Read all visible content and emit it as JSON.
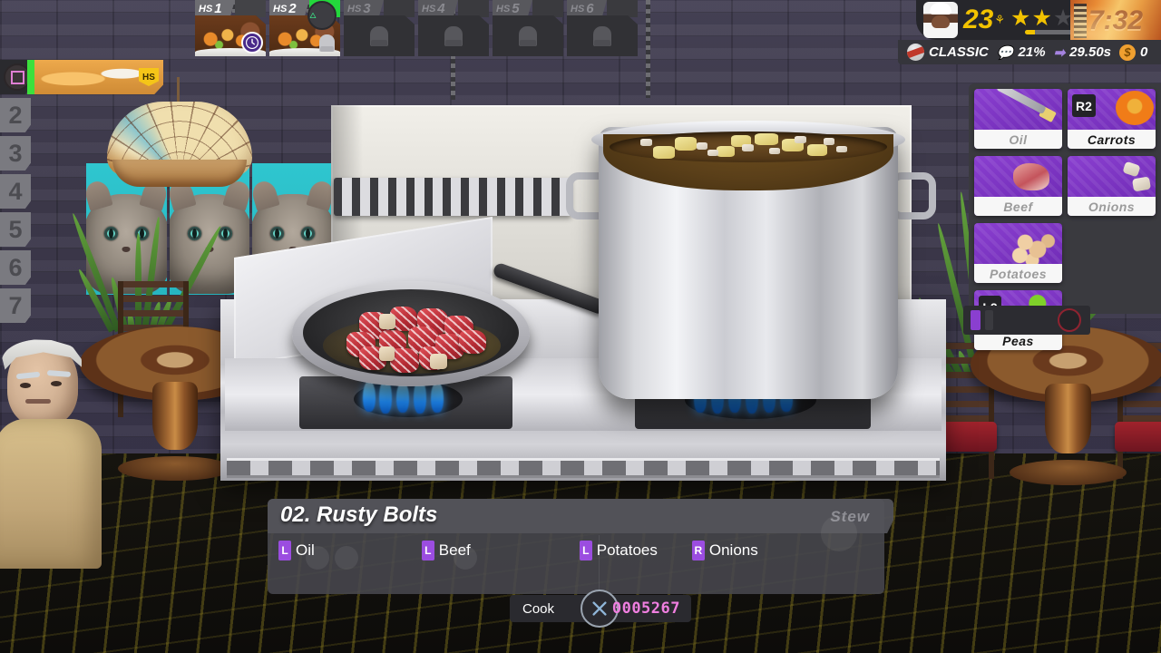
{
  "hud": {
    "score": "23",
    "score_icon": "chopsticks-icon",
    "stars_total": 5,
    "stars_earned": 2,
    "xp_percent": 8,
    "timer": "7:32",
    "mode": "CLASSIC",
    "buzz_percent": "21%",
    "time_remaining": "29.50s",
    "money": "0",
    "accent_gold": "#f2c200",
    "accent_purple": "#9b4de0",
    "accent_pink": "#f07fe0"
  },
  "hold_station": [
    {
      "tab": "HS",
      "num": "1",
      "state": "filled",
      "badge": "clock-icon",
      "top_color": "#434347"
    },
    {
      "tab": "HS",
      "num": "2",
      "state": "filled",
      "badge": "chef-hat-icon",
      "top_color": "#23d83c",
      "button": "triangle-icon"
    },
    {
      "tab": "HS",
      "num": "3",
      "state": "empty",
      "badge": "chef-hat-icon"
    },
    {
      "tab": "HS",
      "num": "4",
      "state": "empty",
      "badge": "chef-hat-icon"
    },
    {
      "tab": "HS",
      "num": "5",
      "state": "empty",
      "badge": "chef-hat-icon"
    },
    {
      "tab": "HS",
      "num": "6",
      "state": "empty",
      "badge": "chef-hat-icon"
    }
  ],
  "order_list": [
    {
      "slot": "1",
      "active": true,
      "button": "square-icon",
      "hs_tag": "HS"
    },
    {
      "slot": "2",
      "active": false
    },
    {
      "slot": "3",
      "active": false
    },
    {
      "slot": "4",
      "active": false
    },
    {
      "slot": "5",
      "active": false
    },
    {
      "slot": "6",
      "active": false
    },
    {
      "slot": "7",
      "active": false
    }
  ],
  "ingredients": [
    {
      "name": "Oil",
      "key": "",
      "ready": false,
      "art": "art-oil"
    },
    {
      "name": "Carrots",
      "key": "R2",
      "ready": true,
      "art": "art-carrot"
    },
    {
      "name": "Beef",
      "key": "",
      "ready": false,
      "art": "art-beef"
    },
    {
      "name": "Onions",
      "key": "",
      "ready": false,
      "art": "art-onion"
    },
    {
      "name": "Potatoes",
      "key": "",
      "ready": false,
      "art": "art-potato"
    },
    {
      "name": "Peas",
      "key": "L2",
      "ready": true,
      "art": "art-peas"
    }
  ],
  "recipe": {
    "title": "02. Rusty Bolts",
    "type": "Stew",
    "steps": [
      {
        "key": "L",
        "name": "Oil"
      },
      {
        "key": "L",
        "name": "Beef"
      },
      {
        "key": "L",
        "name": "Potatoes"
      },
      {
        "key": "R",
        "name": "Onions"
      }
    ]
  },
  "cook_bar": {
    "label": "Cook",
    "button": "cross-icon",
    "code": "0005267"
  }
}
